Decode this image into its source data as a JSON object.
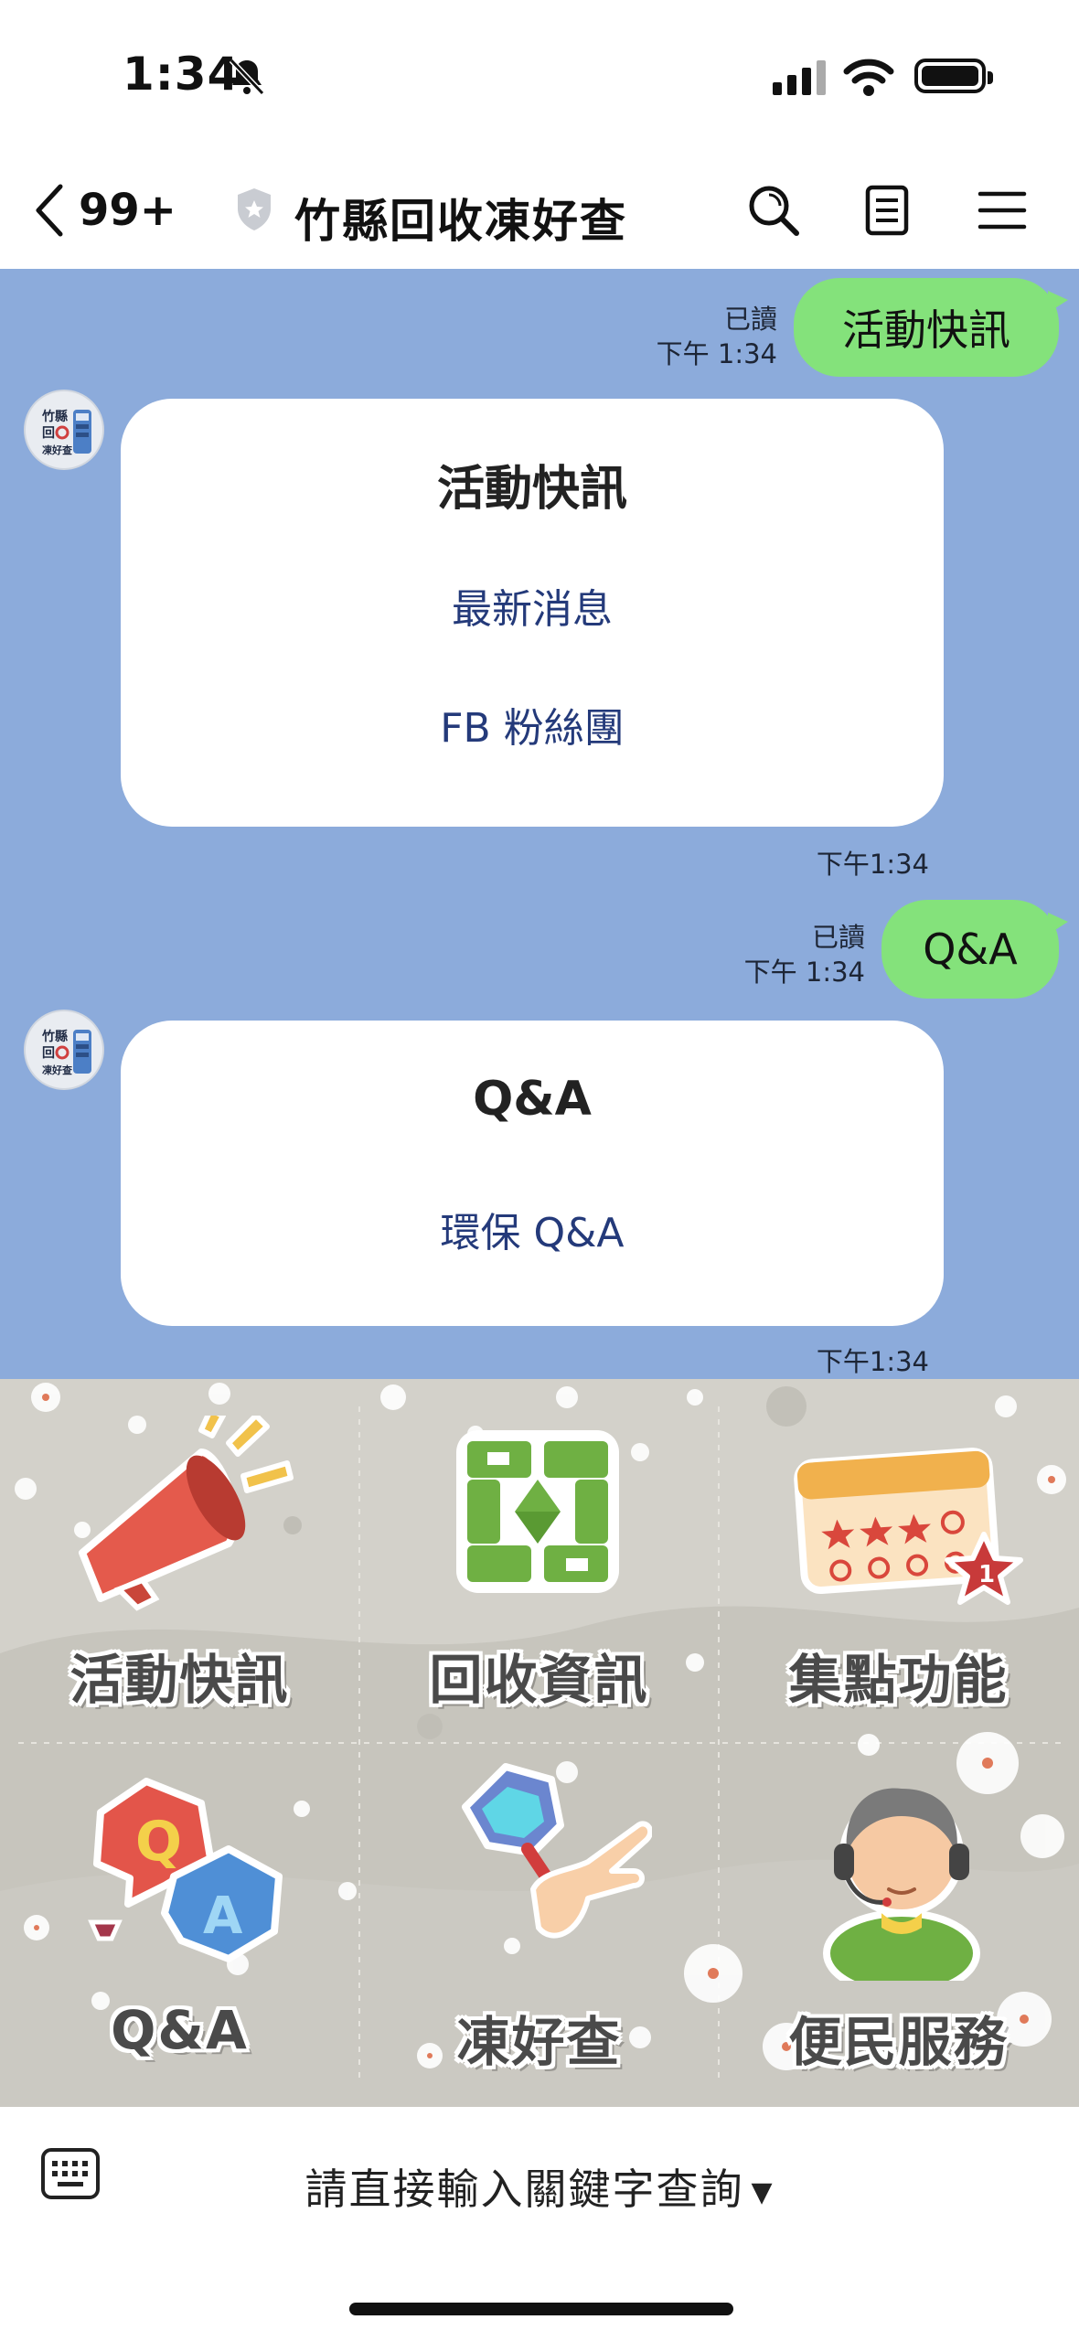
{
  "status_bar": {
    "time": "1:34"
  },
  "header": {
    "back_count": "99+",
    "title": "竹縣回收凍好查"
  },
  "messages": [
    {
      "type": "outgoing",
      "text": "活動快訊",
      "read": "已讀",
      "time": "下午 1:34"
    },
    {
      "type": "card",
      "title": "活動快訊",
      "links": [
        "最新消息",
        "FB 粉絲團"
      ],
      "time": "下午1:34"
    },
    {
      "type": "outgoing",
      "text": "Q&A",
      "read": "已讀",
      "time": "下午 1:34"
    },
    {
      "type": "card",
      "title": "Q&A",
      "links": [
        "環保 Q&A"
      ],
      "time": "下午1:34"
    }
  ],
  "rich_menu": [
    {
      "label": "活動快訊",
      "icon": "megaphone-icon"
    },
    {
      "label": "回收資訊",
      "icon": "recycle-icon"
    },
    {
      "label": "集點功能",
      "icon": "stamp-card-icon"
    },
    {
      "label": "Q&A",
      "icon": "qa-bubbles-icon"
    },
    {
      "label": "凍好查",
      "icon": "search-hand-icon"
    },
    {
      "label": "便民服務",
      "icon": "customer-service-icon"
    }
  ],
  "input_bar": {
    "prompt": "請直接輸入關鍵字查詢"
  },
  "colors": {
    "chat_bg": "#8cabdb",
    "outgoing_bubble": "#84e27b",
    "link": "#243a7a"
  }
}
